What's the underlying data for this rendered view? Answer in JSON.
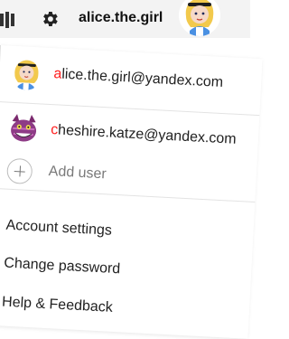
{
  "header": {
    "username": "alice.the.girl",
    "menu_icon": "bars-icon",
    "settings_icon": "gear-icon",
    "avatar_icon": "alice-avatar"
  },
  "accounts": {
    "current": {
      "email_first": "a",
      "email_rest": "lice.the.girl@yandex.com",
      "first_letter_color": "#ff1f1f",
      "avatar_icon": "alice-avatar"
    },
    "other": {
      "email_first": "c",
      "email_rest": "heshire.katze@yandex.com",
      "first_letter_color": "#ff1f1f",
      "avatar_icon": "cheshire-cat-avatar"
    },
    "add_user_label": "Add user"
  },
  "menu": {
    "items": [
      {
        "label": "Account settings"
      },
      {
        "label": "Change password"
      },
      {
        "label": "Help & Feedback"
      }
    ]
  }
}
